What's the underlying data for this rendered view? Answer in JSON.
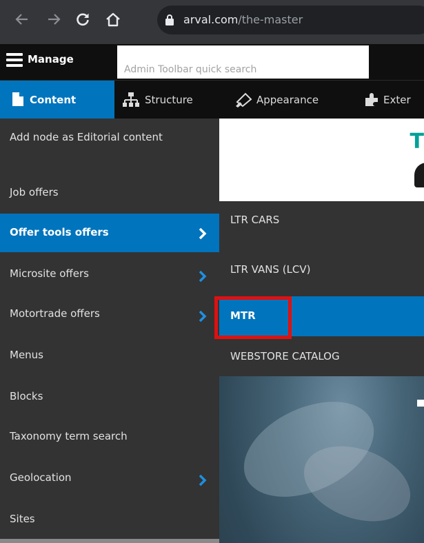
{
  "browser": {
    "url_domain": "arval.com",
    "url_path": "/the-master"
  },
  "toolbar": {
    "manage_label": "Manage",
    "search_placeholder": "Admin Toolbar quick search",
    "tabs": [
      {
        "label": "Content",
        "icon": "document-icon"
      },
      {
        "label": "Structure",
        "icon": "sitemap-icon"
      },
      {
        "label": "Appearance",
        "icon": "paint-brush-icon"
      },
      {
        "label": "Exter",
        "icon": "puzzle-icon"
      }
    ]
  },
  "menu": {
    "items": [
      {
        "label": "Add node as Editorial content"
      },
      {
        "label": "Job offers"
      },
      {
        "label": "Offer tools offers"
      },
      {
        "label": "Microsite offers"
      },
      {
        "label": "Motortrade offers"
      },
      {
        "label": "Menus"
      },
      {
        "label": "Blocks"
      },
      {
        "label": "Taxonomy term search"
      },
      {
        "label": "Geolocation"
      },
      {
        "label": "Sites"
      }
    ]
  },
  "submenu": {
    "items": [
      {
        "label": "LTR CARS"
      },
      {
        "label": "LTR VANS (LCV)"
      },
      {
        "label": "MTR"
      },
      {
        "label": "WEBSTORE CATALOG"
      }
    ]
  },
  "page": {
    "logo_letter": "T"
  },
  "colors": {
    "accent": "#0074bd",
    "menu_bg": "#333333",
    "toolbar_bg": "#0f0f0f",
    "highlight": "#e01010"
  }
}
